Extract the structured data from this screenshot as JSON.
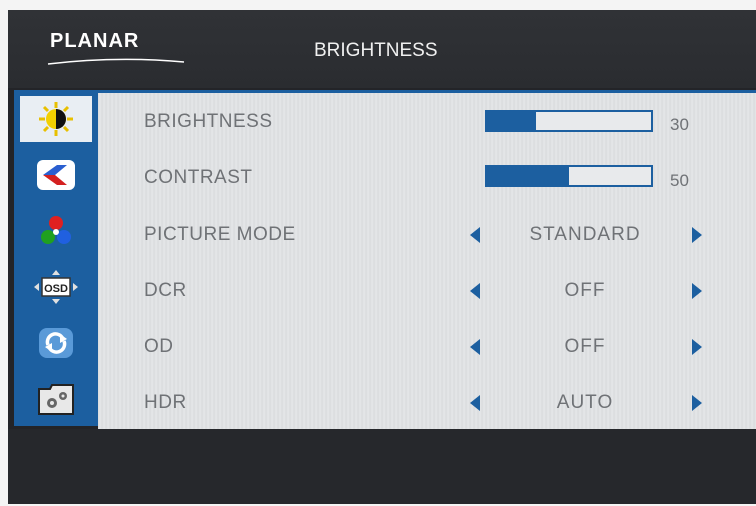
{
  "brand": {
    "logo": "PLANAR"
  },
  "header": {
    "title": "BRIGHTNESS"
  },
  "sidebar": {
    "tabs": [
      {
        "icon": "brightness-icon",
        "active": true
      },
      {
        "icon": "color-icon",
        "active": false
      },
      {
        "icon": "picture-icon",
        "active": false
      },
      {
        "icon": "osd-icon",
        "active": false
      },
      {
        "icon": "reset-icon",
        "active": false
      },
      {
        "icon": "settings-icon",
        "active": false
      }
    ]
  },
  "menu": {
    "brightness": {
      "label": "BRIGHTNESS",
      "value": "30",
      "level": 30
    },
    "contrast": {
      "label": "CONTRAST",
      "value": "50",
      "level": 50
    },
    "picture_mode": {
      "label": "PICTURE MODE",
      "value": "STANDARD"
    },
    "dcr": {
      "label": "DCR",
      "value": "OFF"
    },
    "od": {
      "label": "OD",
      "value": "OFF"
    },
    "hdr": {
      "label": "HDR",
      "value": "AUTO"
    }
  },
  "colors": {
    "accent": "#1c5fa0",
    "text": "#6f7276",
    "header": "#2a2c30"
  }
}
